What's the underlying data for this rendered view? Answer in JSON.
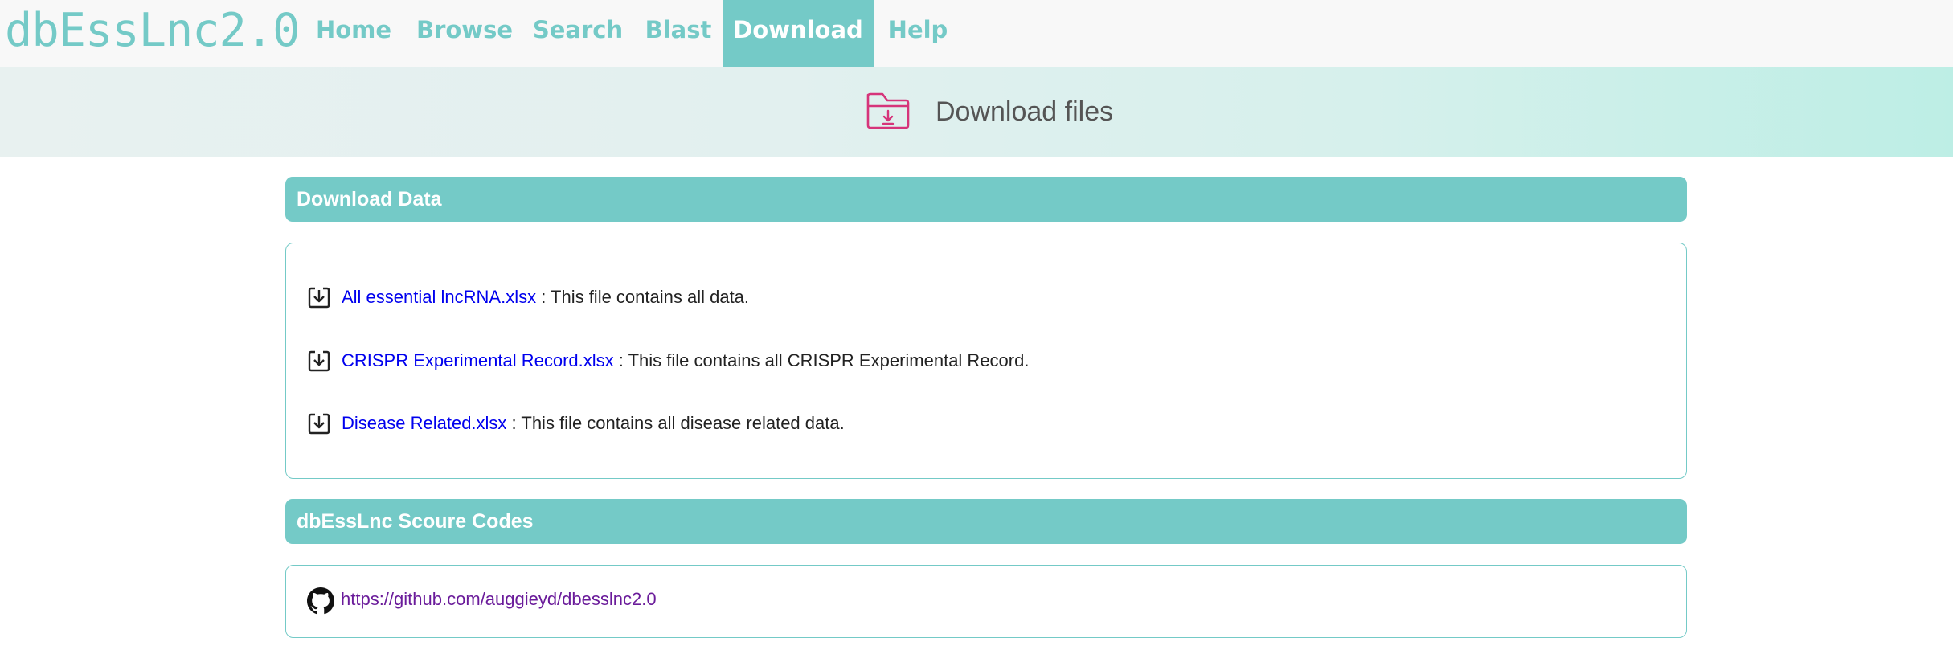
{
  "brand": "dbEssLnc2.0",
  "nav": {
    "items": [
      {
        "label": "Home"
      },
      {
        "label": "Browse"
      },
      {
        "label": "Search"
      },
      {
        "label": "Blast"
      },
      {
        "label": "Download",
        "active": true
      },
      {
        "label": "Help"
      }
    ]
  },
  "banner": {
    "title": "Download files",
    "icon": "folder-download-icon"
  },
  "download_section": {
    "title": "Download Data",
    "files": [
      {
        "link": "All essential lncRNA.xlsx",
        "description": " : This file contains all data.",
        "icon": "download-icon"
      },
      {
        "link": "CRISPR Experimental Record.xlsx",
        "description": " : This file contains all CRISPR Experimental Record.",
        "icon": "download-icon"
      },
      {
        "link": "Disease Related.xlsx",
        "description": " : This file contains all disease related data.",
        "icon": "download-icon"
      }
    ]
  },
  "source_section": {
    "title": "dbEssLnc Scoure Codes",
    "link": "https://github.com/auggieyd/dbesslnc2.0",
    "icon": "github-icon"
  },
  "colors": {
    "accent": "#74cac7",
    "link": "#0000ee",
    "visited_link": "#6a1b9a",
    "banner_icon": "#d6347a"
  }
}
